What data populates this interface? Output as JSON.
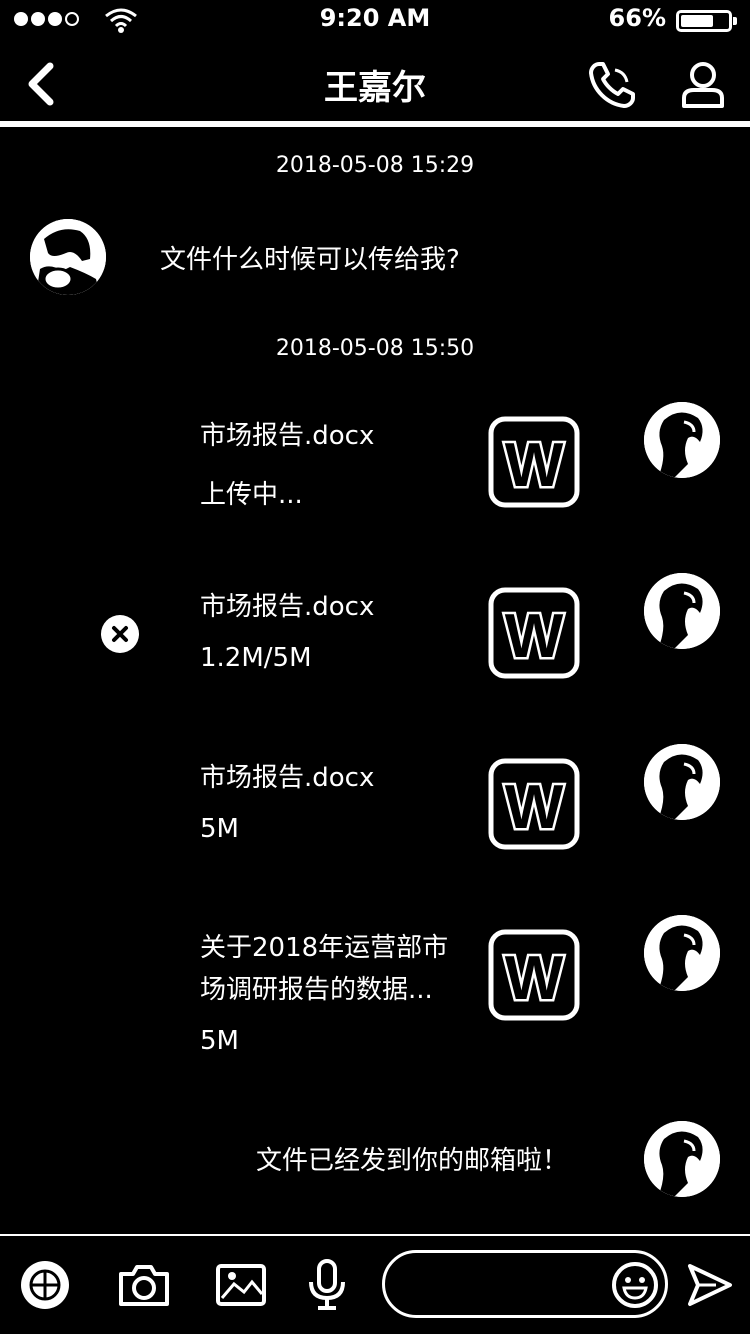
{
  "status_bar": {
    "time": "9:20 AM",
    "battery": "66%",
    "battery_level": 0.66
  },
  "header": {
    "title": "王嘉尔"
  },
  "messages": [
    {
      "type": "timestamp",
      "text": "2018-05-08 15:29"
    },
    {
      "type": "incoming_text",
      "text": "文件什么时候可以传给我?"
    },
    {
      "type": "timestamp",
      "text": "2018-05-08 15:50"
    },
    {
      "type": "outgoing_file",
      "name": "市场报告.docx",
      "status": "上传中..."
    },
    {
      "type": "outgoing_file",
      "name": "市场报告.docx",
      "status": "1.2M/5M",
      "has_cancel": true
    },
    {
      "type": "outgoing_file",
      "name": "市场报告.docx",
      "status": "5M"
    },
    {
      "type": "outgoing_file",
      "name_line1": "关于2018年运营部市",
      "name_line2": "场调研报告的数据...",
      "status": "5M"
    },
    {
      "type": "outgoing_text",
      "text": "文件已经发到你的邮箱啦！"
    }
  ],
  "toolbar": {
    "icons": [
      "grid-icon",
      "camera-icon",
      "image-icon",
      "microphone-icon"
    ],
    "input_placeholder": "",
    "emoji_icon": "smiley-icon",
    "send_icon": "send-icon"
  },
  "file_icon_letter": "W"
}
